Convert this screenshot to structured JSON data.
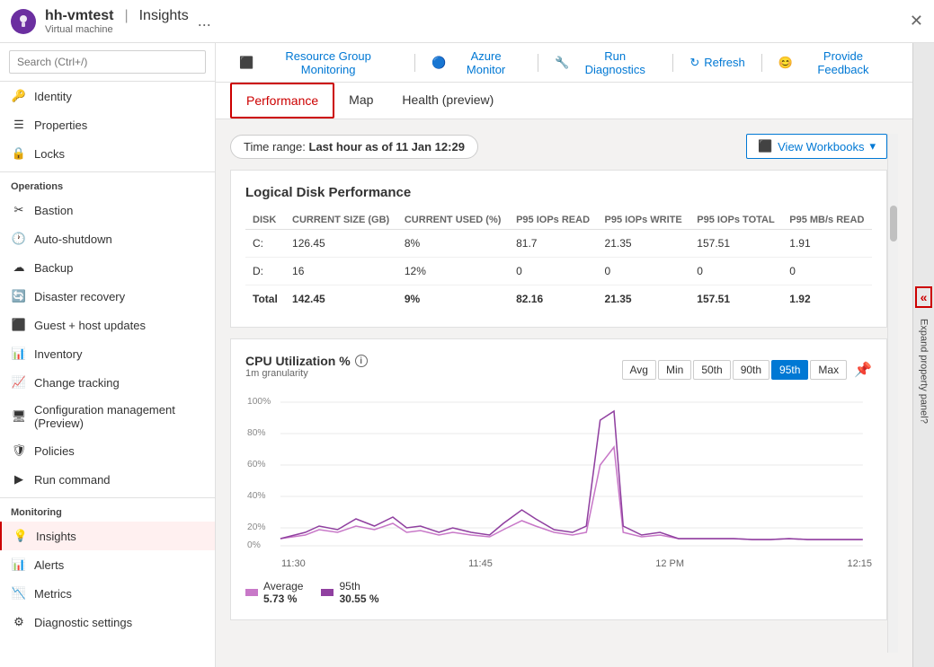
{
  "header": {
    "title": "hh-vmtest",
    "subtitle": "Virtual machine",
    "separator": "|",
    "insights_label": "Insights",
    "dots_label": "...",
    "close_label": "✕"
  },
  "sidebar": {
    "search_placeholder": "Search (Ctrl+/)",
    "items_top": [
      {
        "id": "identity",
        "label": "Identity",
        "icon": "key"
      },
      {
        "id": "properties",
        "label": "Properties",
        "icon": "list"
      },
      {
        "id": "locks",
        "label": "Locks",
        "icon": "lock"
      }
    ],
    "section_operations": "Operations",
    "items_operations": [
      {
        "id": "bastion",
        "label": "Bastion",
        "icon": "bastion"
      },
      {
        "id": "auto-shutdown",
        "label": "Auto-shutdown",
        "icon": "clock"
      },
      {
        "id": "backup",
        "label": "Backup",
        "icon": "backup"
      },
      {
        "id": "disaster-recovery",
        "label": "Disaster recovery",
        "icon": "dr"
      },
      {
        "id": "guest-host-updates",
        "label": "Guest + host updates",
        "icon": "update"
      },
      {
        "id": "inventory",
        "label": "Inventory",
        "icon": "inventory"
      },
      {
        "id": "change-tracking",
        "label": "Change tracking",
        "icon": "tracking"
      },
      {
        "id": "config-management",
        "label": "Configuration management (Preview)",
        "icon": "config"
      },
      {
        "id": "policies",
        "label": "Policies",
        "icon": "policy"
      },
      {
        "id": "run-command",
        "label": "Run command",
        "icon": "run"
      }
    ],
    "section_monitoring": "Monitoring",
    "items_monitoring": [
      {
        "id": "insights",
        "label": "Insights",
        "icon": "insights",
        "active": true
      },
      {
        "id": "alerts",
        "label": "Alerts",
        "icon": "alerts"
      },
      {
        "id": "metrics",
        "label": "Metrics",
        "icon": "metrics"
      },
      {
        "id": "diagnostic-settings",
        "label": "Diagnostic settings",
        "icon": "diagnostic"
      }
    ]
  },
  "toolbar": {
    "buttons": [
      {
        "id": "resource-group-monitoring",
        "label": "Resource Group Monitoring",
        "icon": "monitor"
      },
      {
        "id": "azure-monitor",
        "label": "Azure Monitor",
        "icon": "azure-monitor"
      },
      {
        "id": "run-diagnostics",
        "label": "Run Diagnostics",
        "icon": "wrench"
      },
      {
        "id": "refresh",
        "label": "Refresh",
        "icon": "refresh"
      },
      {
        "id": "provide-feedback",
        "label": "Provide Feedback",
        "icon": "feedback"
      }
    ]
  },
  "tabs": [
    {
      "id": "performance",
      "label": "Performance",
      "active": true
    },
    {
      "id": "map",
      "label": "Map",
      "active": false
    },
    {
      "id": "health",
      "label": "Health (preview)",
      "active": false
    }
  ],
  "time_range": {
    "label": "Time range:",
    "value": "Last hour as of 11 Jan 12:29"
  },
  "view_workbooks_label": "View Workbooks",
  "disk_table": {
    "title": "Logical Disk Performance",
    "headers": [
      "DISK",
      "CURRENT SIZE (GB)",
      "CURRENT USED (%)",
      "P95 IOPs READ",
      "P95 IOPs WRITE",
      "P95 IOPs TOTAL",
      "P95 MB/s READ"
    ],
    "rows": [
      {
        "disk": "C:",
        "size": "126.45",
        "used": "8%",
        "iops_read": "81.7",
        "iops_write": "21.35",
        "iops_total": "157.51",
        "mb_read": "1.91"
      },
      {
        "disk": "D:",
        "size": "16",
        "used": "12%",
        "iops_read": "0",
        "iops_write": "0",
        "iops_total": "0",
        "mb_read": "0"
      },
      {
        "disk": "Total",
        "size": "142.45",
        "used": "9%",
        "iops_read": "82.16",
        "iops_write": "21.35",
        "iops_total": "157.51",
        "mb_read": "1.92"
      }
    ]
  },
  "cpu_chart": {
    "title": "CPU Utilization %",
    "subtitle": "1m granularity",
    "buttons": [
      "Avg",
      "Min",
      "50th",
      "90th",
      "95th",
      "Max"
    ],
    "active_button": "95th",
    "y_labels": [
      "100%",
      "80%",
      "60%",
      "40%",
      "20%",
      "0%"
    ],
    "x_labels": [
      "11:30",
      "11:45",
      "12 PM",
      "12:15"
    ],
    "legend": [
      {
        "label": "Average",
        "value": "5.73 %",
        "color": "#c070c0"
      },
      {
        "label": "95th",
        "value": "30.55 %",
        "color": "#a050a0"
      }
    ]
  },
  "expand_panel_label": "Expand property panel?"
}
